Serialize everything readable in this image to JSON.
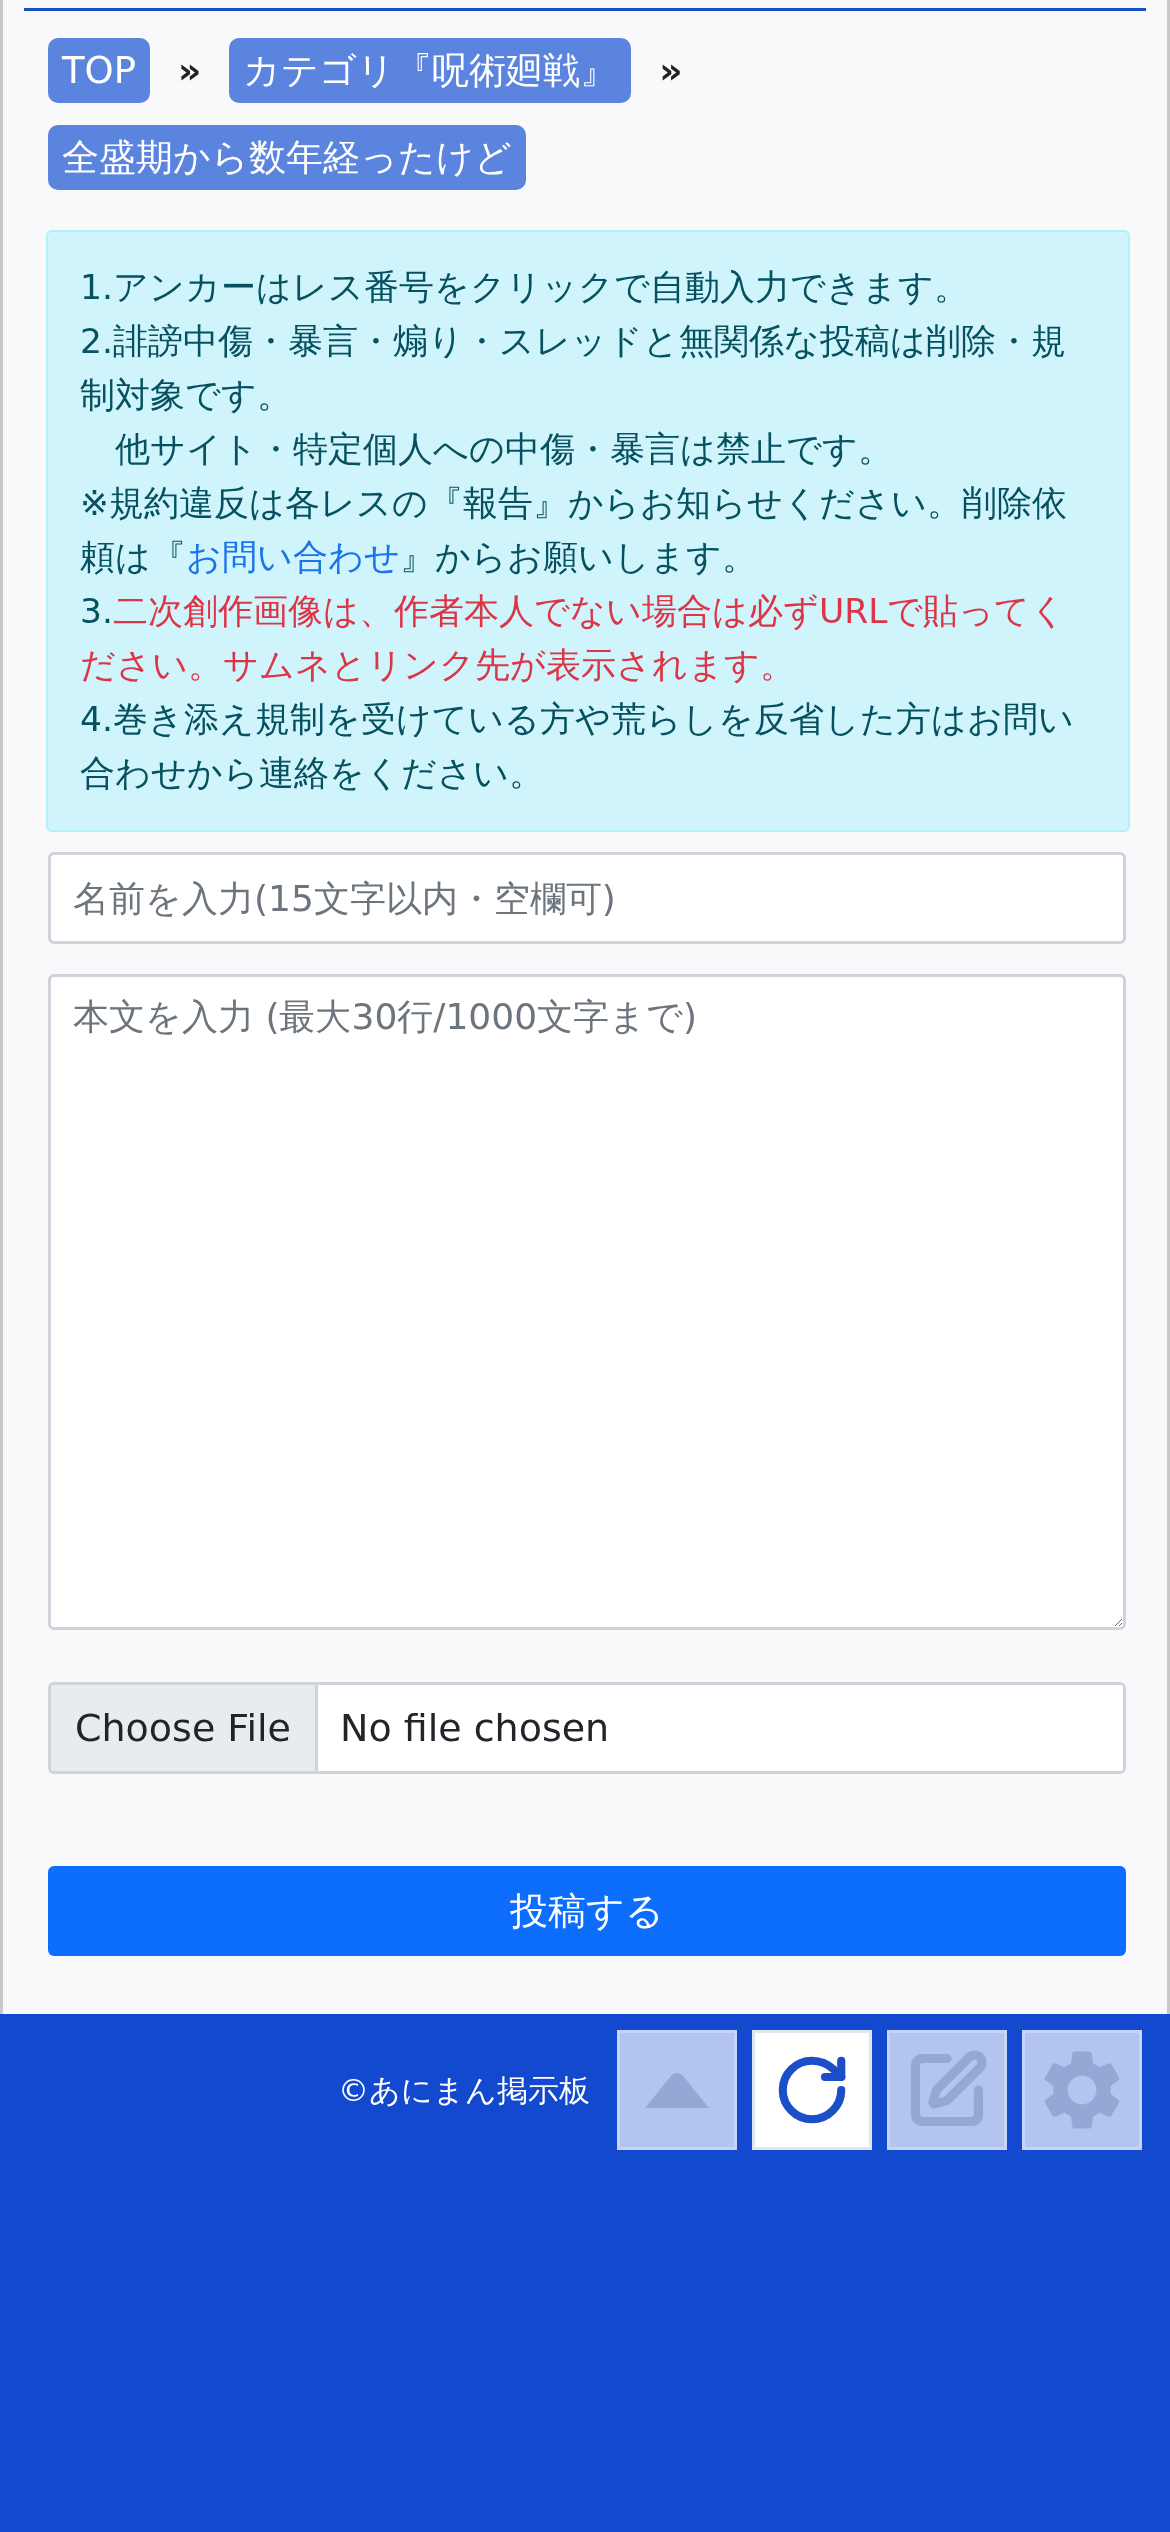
{
  "breadcrumbs": [
    {
      "kind": "link",
      "text": "TOP"
    },
    {
      "kind": "separator",
      "text": "»"
    },
    {
      "kind": "link",
      "text": "カテゴリ『呪術廻戦』"
    },
    {
      "kind": "separator",
      "text": "»"
    },
    {
      "kind": "link",
      "text": "全盛期から数年経ったけど"
    }
  ],
  "notice": [
    {
      "segments": [
        {
          "kind": "text",
          "text": "1.アンカーはレス番号をクリックで自動入力できます。"
        }
      ]
    },
    {
      "segments": [
        {
          "kind": "text",
          "text": "2.誹謗中傷・暴言・煽り・スレッドと無関係な投稿は削除・規制対象です。"
        }
      ]
    },
    {
      "segments": [
        {
          "kind": "text",
          "text": "　他サイト・特定個人への中傷・暴言は禁止です。"
        }
      ]
    },
    {
      "segments": [
        {
          "kind": "text",
          "text": "※規約違反は各レスの『報告』からお知らせください。削除依頼は『"
        },
        {
          "kind": "link",
          "text": "お問い合わせ"
        },
        {
          "kind": "text",
          "text": "』からお願いします。"
        }
      ]
    },
    {
      "segments": [
        {
          "kind": "text",
          "text": "3."
        },
        {
          "kind": "warning",
          "text": "二次創作画像は、作者本人でない場合は必ずURLで貼ってください。サムネとリンク先が表示されます。"
        }
      ]
    },
    {
      "segments": [
        {
          "kind": "text",
          "text": "4.巻き添え規制を受けている方や荒らしを反省した方はお問い合わせから連絡をください。"
        }
      ]
    }
  ],
  "name_field": {
    "placeholder": "名前を入力(15文字以内・空欄可)"
  },
  "body_field": {
    "placeholder": "本文を入力 (最大30行/1000文字まで)"
  },
  "file_input": {
    "button": "Choose File",
    "status": "No file chosen"
  },
  "submit_button": "投稿する",
  "footer": {
    "copyright": "©あにまん掲示板"
  },
  "toolbar": [
    {
      "kind": "top",
      "disabled": true
    },
    {
      "kind": "reload",
      "disabled": false
    },
    {
      "kind": "write",
      "disabled": true
    },
    {
      "kind": "settings",
      "disabled": true
    }
  ]
}
